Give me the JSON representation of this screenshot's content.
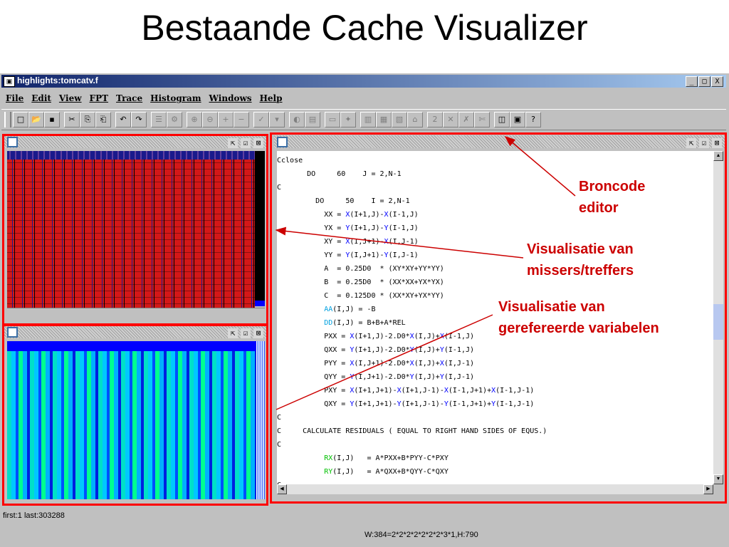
{
  "slide": {
    "title": "Bestaande Cache Visualizer"
  },
  "window": {
    "title": "highlights:tomcatv.f",
    "buttons": [
      "_",
      "□",
      "X"
    ]
  },
  "menu": [
    "File",
    "Edit",
    "View",
    "FPT",
    "Trace",
    "Histogram",
    "Windows",
    "Help"
  ],
  "toolbar": {
    "icons": [
      "new-icon",
      "open-icon",
      "save-icon",
      "cut-icon",
      "copy-icon",
      "paste-icon",
      "undo-icon",
      "redo-icon",
      "list-icon",
      "settings-icon",
      "zoom-in-icon",
      "zoom-out-icon",
      "plus-icon",
      "minus-icon",
      "check-icon",
      "filter-icon",
      "toggle-icon",
      "layers-icon",
      "window-icon",
      "tool-icon",
      "stats-icon",
      "grid-icon",
      "chart-icon",
      "log-icon",
      "2d-icon",
      "cross-icon",
      "cancel-icon",
      "scissors-icon",
      "columns-icon",
      "panels-icon",
      "help-icon"
    ]
  },
  "panes": {
    "frame_buttons": [
      "⇱",
      "☑",
      "⊠"
    ]
  },
  "code": {
    "lines": [
      [
        {
          "t": "Cclose",
          "c": "k"
        }
      ],
      [
        {
          "t": "       DO     60    J = 2,N-1",
          "c": "k"
        }
      ],
      [
        {
          "t": "C",
          "c": "k"
        }
      ],
      [
        {
          "t": "         DO     50    I = 2,N-1",
          "c": "k"
        }
      ],
      [
        {
          "t": "           XX = ",
          "c": "k"
        },
        {
          "t": "X",
          "c": "b"
        },
        {
          "t": "(I+1,J)-",
          "c": "k"
        },
        {
          "t": "X",
          "c": "b"
        },
        {
          "t": "(I-1,J)",
          "c": "k"
        }
      ],
      [
        {
          "t": "           YX = ",
          "c": "k"
        },
        {
          "t": "Y",
          "c": "b"
        },
        {
          "t": "(I+1,J)-",
          "c": "k"
        },
        {
          "t": "Y",
          "c": "b"
        },
        {
          "t": "(I-1,J)",
          "c": "k"
        }
      ],
      [
        {
          "t": "           XY = ",
          "c": "k"
        },
        {
          "t": "X",
          "c": "b"
        },
        {
          "t": "(I,J+1)-",
          "c": "k"
        },
        {
          "t": "X",
          "c": "b"
        },
        {
          "t": "(I,J-1)",
          "c": "k"
        }
      ],
      [
        {
          "t": "           YY = ",
          "c": "k"
        },
        {
          "t": "Y",
          "c": "b"
        },
        {
          "t": "(I,J+1)-",
          "c": "k"
        },
        {
          "t": "Y",
          "c": "b"
        },
        {
          "t": "(I,J-1)",
          "c": "k"
        }
      ],
      [
        {
          "t": "           A  = 0.25D0  * (XY*XY+YY*YY)",
          "c": "k"
        }
      ],
      [
        {
          "t": "           B  = 0.25D0  * (XX*XX+YX*YX)",
          "c": "k"
        }
      ],
      [
        {
          "t": "           C  = 0.125D0 * (XX*XY+YX*YY)",
          "c": "k"
        }
      ],
      [
        {
          "t": "           ",
          "c": "k"
        },
        {
          "t": "AA",
          "c": "c"
        },
        {
          "t": "(I,J) = -B",
          "c": "k"
        }
      ],
      [
        {
          "t": "           ",
          "c": "k"
        },
        {
          "t": "DD",
          "c": "c"
        },
        {
          "t": "(I,J) = B+B+A*REL",
          "c": "k"
        }
      ],
      [
        {
          "t": "           PXX = ",
          "c": "k"
        },
        {
          "t": "X",
          "c": "b"
        },
        {
          "t": "(I+1,J)-2.D0*",
          "c": "k"
        },
        {
          "t": "X",
          "c": "b"
        },
        {
          "t": "(I,J)+",
          "c": "k"
        },
        {
          "t": "X",
          "c": "b"
        },
        {
          "t": "(I-1,J)",
          "c": "k"
        }
      ],
      [
        {
          "t": "           QXX = ",
          "c": "k"
        },
        {
          "t": "Y",
          "c": "b"
        },
        {
          "t": "(I+1,J)-2.D0*",
          "c": "k"
        },
        {
          "t": "Y",
          "c": "b"
        },
        {
          "t": "(I,J)+",
          "c": "k"
        },
        {
          "t": "Y",
          "c": "b"
        },
        {
          "t": "(I-1,J)",
          "c": "k"
        }
      ],
      [
        {
          "t": "           PYY = ",
          "c": "k"
        },
        {
          "t": "X",
          "c": "b"
        },
        {
          "t": "(I,J+1)-2.D0*",
          "c": "k"
        },
        {
          "t": "X",
          "c": "b"
        },
        {
          "t": "(I,J)+",
          "c": "k"
        },
        {
          "t": "X",
          "c": "b"
        },
        {
          "t": "(I,J-1)",
          "c": "k"
        }
      ],
      [
        {
          "t": "           QYY = ",
          "c": "k"
        },
        {
          "t": "Y",
          "c": "b"
        },
        {
          "t": "(I,J+1)-2.D0*",
          "c": "k"
        },
        {
          "t": "Y",
          "c": "b"
        },
        {
          "t": "(I,J)+",
          "c": "k"
        },
        {
          "t": "Y",
          "c": "b"
        },
        {
          "t": "(I,J-1)",
          "c": "k"
        }
      ],
      [
        {
          "t": "           PXY = ",
          "c": "k"
        },
        {
          "t": "X",
          "c": "b"
        },
        {
          "t": "(I+1,J+1)-",
          "c": "k"
        },
        {
          "t": "X",
          "c": "b"
        },
        {
          "t": "(I+1,J-1)-",
          "c": "k"
        },
        {
          "t": "X",
          "c": "b"
        },
        {
          "t": "(I-1,J+1)+",
          "c": "k"
        },
        {
          "t": "X",
          "c": "b"
        },
        {
          "t": "(I-1,J-1)",
          "c": "k"
        }
      ],
      [
        {
          "t": "           QXY = ",
          "c": "k"
        },
        {
          "t": "Y",
          "c": "b"
        },
        {
          "t": "(I+1,J+1)-",
          "c": "k"
        },
        {
          "t": "Y",
          "c": "b"
        },
        {
          "t": "(I+1,J-1)-",
          "c": "k"
        },
        {
          "t": "Y",
          "c": "b"
        },
        {
          "t": "(I-1,J+1)+",
          "c": "k"
        },
        {
          "t": "Y",
          "c": "b"
        },
        {
          "t": "(I-1,J-1)",
          "c": "k"
        }
      ],
      [
        {
          "t": "C",
          "c": "k"
        }
      ],
      [
        {
          "t": "C     CALCULATE RESIDUALS ( EQUAL TO RIGHT HAND SIDES OF EQUS.)",
          "c": "k"
        }
      ],
      [
        {
          "t": "C",
          "c": "k"
        }
      ],
      [
        {
          "t": "           ",
          "c": "k"
        },
        {
          "t": "RX",
          "c": "g"
        },
        {
          "t": "(I,J)   = A*PXX+B*PYY-C*PXY",
          "c": "k"
        }
      ],
      [
        {
          "t": "           ",
          "c": "k"
        },
        {
          "t": "RY",
          "c": "g"
        },
        {
          "t": "(I,J)   = A*QXX+B*QYY-C*QXY",
          "c": "k"
        }
      ],
      [
        {
          "t": "C",
          "c": "k"
        }
      ]
    ]
  },
  "colors": {
    "k": "#000000",
    "b": "#0000ff",
    "c": "#00a0e0",
    "g": "#00c000",
    "highlight": "#ff0000",
    "annotation": "#cc0000"
  },
  "status": {
    "left": "first:1 last:303288",
    "right": "W:384=2*2*2*2*2*2*2*3*1,H:790"
  },
  "annotations": {
    "broncode": [
      "Broncode",
      "editor"
    ],
    "missers": [
      "Visualisatie van",
      "missers/treffers"
    ],
    "variabelen": [
      "Visualisatie van",
      "gerefereerde variabelen"
    ]
  }
}
